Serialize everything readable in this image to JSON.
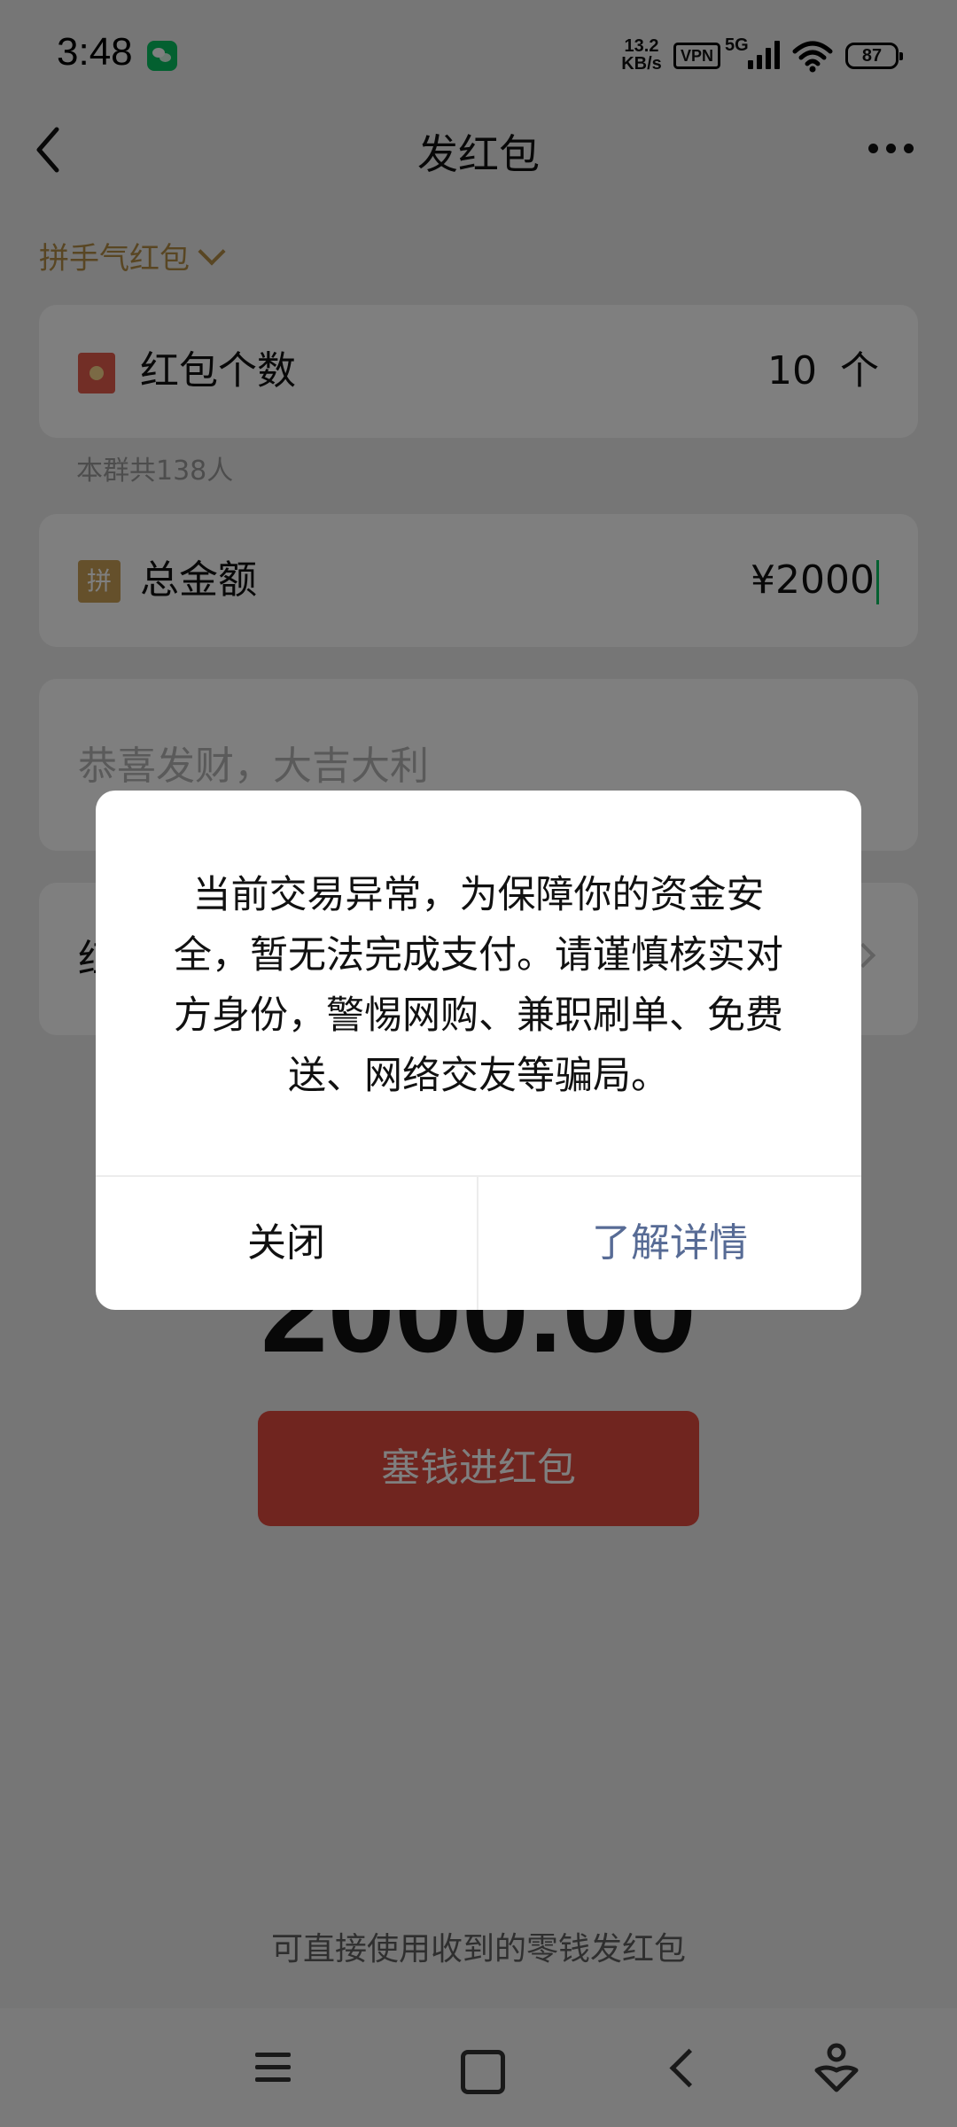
{
  "status_bar": {
    "time": "3:48",
    "net_speed_value": "13.2",
    "net_speed_unit": "KB/s",
    "vpn": "VPN",
    "network": "5G",
    "battery": "87"
  },
  "nav": {
    "title": "发红包"
  },
  "form": {
    "packet_type": "拼手气红包",
    "count_label": "红包个数",
    "count_value": "10",
    "count_unit": "个",
    "member_note": "本群共138人",
    "amount_icon_text": "拼",
    "amount_label": "总金额",
    "amount_value": "¥2000",
    "greeting_placeholder": "恭喜发财，大吉大利",
    "cover_label": "红"
  },
  "summary": {
    "total": "2000.00",
    "send_button": "塞钱进红包",
    "footer_hint": "可直接使用收到的零钱发红包"
  },
  "dialog": {
    "message": "当前交易异常，为保障你的资金安全，暂无法完成支付。请谨慎核实对方身份，警惕网购、兼职刷单、免费送、网络交友等骗局。",
    "close_button": "关闭",
    "details_button": "了解详情"
  },
  "icons": [
    "wechat-notification-icon",
    "back-arrow-icon",
    "more-icon",
    "chevron-down-icon",
    "red-packet-icon",
    "pin-icon",
    "chevron-right-icon",
    "menu-icon",
    "home-icon",
    "back-icon",
    "assistant-icon"
  ],
  "colors": {
    "accent_gold": "#b28d46",
    "send_red": "#e14a3e",
    "link_blue": "#576b95"
  }
}
